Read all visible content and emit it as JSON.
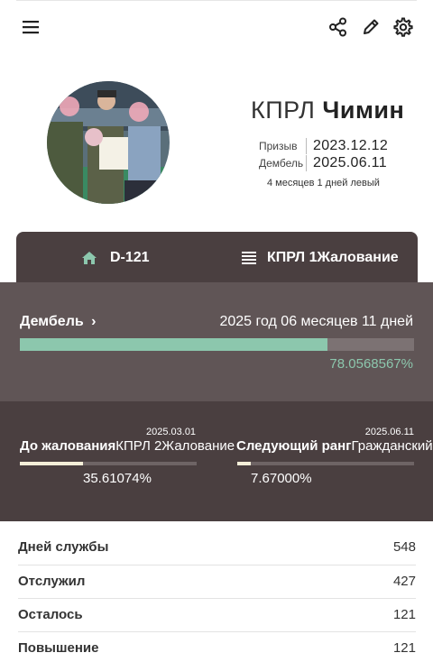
{
  "header": {
    "menu_icon": "hamburger-menu-icon",
    "share_icon": "share-icon",
    "edit_icon": "pencil-icon",
    "settings_icon": "gear-icon"
  },
  "profile": {
    "rank": "КПРЛ",
    "name": "Чимин",
    "enlist_label": "Призыв",
    "enlist_date": "2023.12.12",
    "discharge_label": "Дембель",
    "discharge_date": "2025.06.11",
    "remaining_text": "4 месяцев 1 дней левый"
  },
  "tabs": [
    {
      "icon": "home-icon",
      "label": "D-121"
    },
    {
      "icon": "list-icon",
      "label": "КПРЛ 1Жалование"
    }
  ],
  "discharge_progress": {
    "label": "Дембель",
    "detail": "2025 год 06 месяцев 11 дней",
    "percent_text": "78.0568567%",
    "fraction": 0.780568567
  },
  "sub_progress": [
    {
      "date": "2025.03.01",
      "label_bold": "До жалования",
      "label_rest": "КПРЛ 2Жалование",
      "percent_text": "35.61074%",
      "fraction": 0.3561074
    },
    {
      "date": "2025.06.11",
      "label_bold": "Следующий ранг",
      "label_rest": "Гражданский",
      "percent_text": "7.67000%",
      "fraction": 0.0767
    }
  ],
  "stats": [
    {
      "label": "Дней службы",
      "value": "548"
    },
    {
      "label": "Отслужил",
      "value": "427"
    },
    {
      "label": "Осталось",
      "value": "121"
    },
    {
      "label": "Повышение",
      "value": "121"
    }
  ],
  "colors": {
    "accent_green": "#8cc7ad",
    "dark_panel": "#4a3f40",
    "mid_panel": "#605556",
    "cream": "#f5efd9"
  }
}
